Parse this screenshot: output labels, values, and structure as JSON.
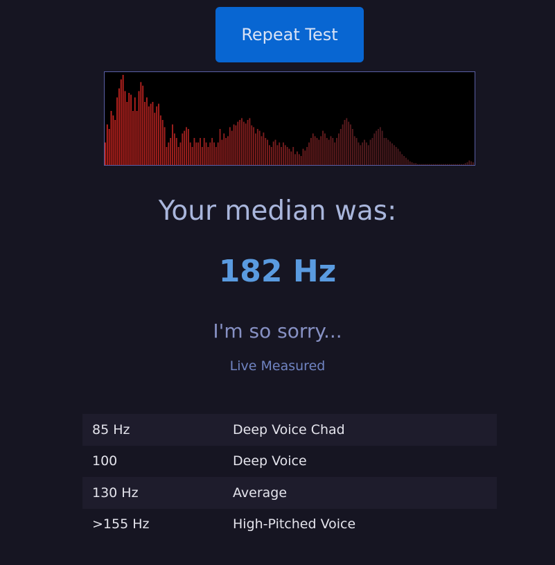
{
  "repeat_button": {
    "label": "Repeat Test"
  },
  "spectrum": {
    "bar_color_bright": "#c4231f",
    "bar_color_dim": "#4a1a1e",
    "border_color": "#5a5fa6",
    "levels": [
      0.25,
      0.45,
      0.4,
      0.6,
      0.55,
      0.5,
      0.75,
      0.85,
      0.95,
      1.0,
      0.82,
      0.7,
      0.8,
      0.78,
      0.6,
      0.75,
      0.6,
      0.82,
      0.92,
      0.88,
      0.7,
      0.75,
      0.65,
      0.68,
      0.7,
      0.58,
      0.65,
      0.68,
      0.55,
      0.5,
      0.42,
      0.2,
      0.25,
      0.3,
      0.45,
      0.35,
      0.3,
      0.2,
      0.25,
      0.35,
      0.38,
      0.42,
      0.4,
      0.25,
      0.2,
      0.3,
      0.25,
      0.25,
      0.3,
      0.2,
      0.3,
      0.25,
      0.2,
      0.25,
      0.3,
      0.25,
      0.2,
      0.25,
      0.4,
      0.28,
      0.35,
      0.3,
      0.32,
      0.42,
      0.38,
      0.45,
      0.44,
      0.48,
      0.5,
      0.52,
      0.48,
      0.46,
      0.5,
      0.52,
      0.44,
      0.42,
      0.35,
      0.4,
      0.38,
      0.32,
      0.36,
      0.3,
      0.28,
      0.22,
      0.2,
      0.26,
      0.28,
      0.22,
      0.25,
      0.2,
      0.25,
      0.22,
      0.2,
      0.18,
      0.15,
      0.2,
      0.12,
      0.15,
      0.12,
      0.1,
      0.18,
      0.16,
      0.2,
      0.25,
      0.3,
      0.35,
      0.32,
      0.3,
      0.28,
      0.32,
      0.38,
      0.35,
      0.3,
      0.28,
      0.32,
      0.3,
      0.25,
      0.3,
      0.35,
      0.4,
      0.45,
      0.5,
      0.52,
      0.48,
      0.45,
      0.4,
      0.32,
      0.3,
      0.25,
      0.22,
      0.25,
      0.28,
      0.25,
      0.22,
      0.28,
      0.3,
      0.35,
      0.38,
      0.4,
      0.42,
      0.38,
      0.3,
      0.3,
      0.28,
      0.26,
      0.24,
      0.22,
      0.2,
      0.18,
      0.15,
      0.12,
      0.1,
      0.08,
      0.06,
      0.04,
      0.03,
      0.02,
      0.02,
      0.01,
      0.01,
      0.01,
      0.01,
      0.01,
      0.01,
      0.01,
      0.01,
      0.01,
      0.01,
      0.01,
      0.01,
      0.01,
      0.01,
      0.01,
      0.01,
      0.01,
      0.01,
      0.01,
      0.01,
      0.01,
      0.01,
      0.01,
      0.01,
      0.02,
      0.03,
      0.05,
      0.04,
      0.03
    ]
  },
  "result": {
    "label": "Your median was:",
    "value": "182 Hz",
    "verdict": "I'm so sorry...",
    "mode": "Live Measured"
  },
  "reference": [
    {
      "freq": "85 Hz",
      "desc": "Deep Voice Chad"
    },
    {
      "freq": "100",
      "desc": "Deep Voice"
    },
    {
      "freq": "130 Hz",
      "desc": "Average"
    },
    {
      "freq": ">155 Hz",
      "desc": "High-Pitched Voice"
    }
  ]
}
